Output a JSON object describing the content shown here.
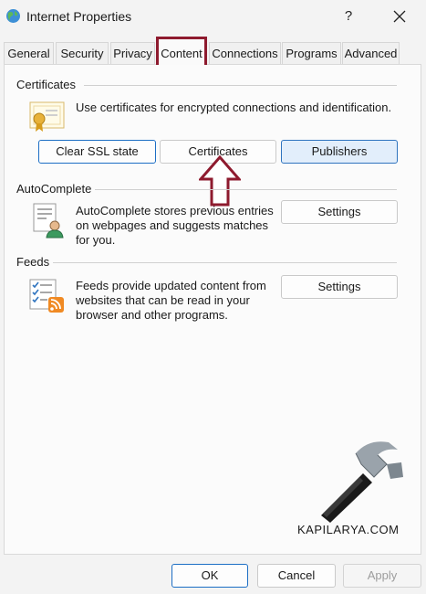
{
  "window": {
    "title": "Internet Properties",
    "help_label": "?"
  },
  "tabs": [
    "General",
    "Security",
    "Privacy",
    "Content",
    "Connections",
    "Programs",
    "Advanced"
  ],
  "active_tab": "Content",
  "certificates": {
    "label": "Certificates",
    "description": "Use certificates for encrypted connections and identification.",
    "clear_ssl_label": "Clear SSL state",
    "certificates_label": "Certificates",
    "publishers_label": "Publishers"
  },
  "autocomplete": {
    "label": "AutoComplete",
    "lines": [
      "AutoComplete stores previous entries",
      "on webpages and suggests matches",
      "for you."
    ],
    "settings_label": "Settings"
  },
  "feeds": {
    "label": "Feeds",
    "lines": [
      "Feeds provide updated content from",
      "websites that can be read in your",
      "browser and other programs."
    ],
    "settings_label": "Settings"
  },
  "watermark": "KAPILARYA.COM",
  "footer": {
    "ok_label": "OK",
    "cancel_label": "Cancel",
    "apply_label": "Apply"
  },
  "colors": {
    "highlight": "#8e1a2e",
    "accent": "#1c6ec4"
  },
  "icons": [
    "globe-icon",
    "close-icon",
    "certificate-icon",
    "autocomplete-icon",
    "feeds-icon",
    "up-arrow-icon",
    "hammer-icon"
  ]
}
